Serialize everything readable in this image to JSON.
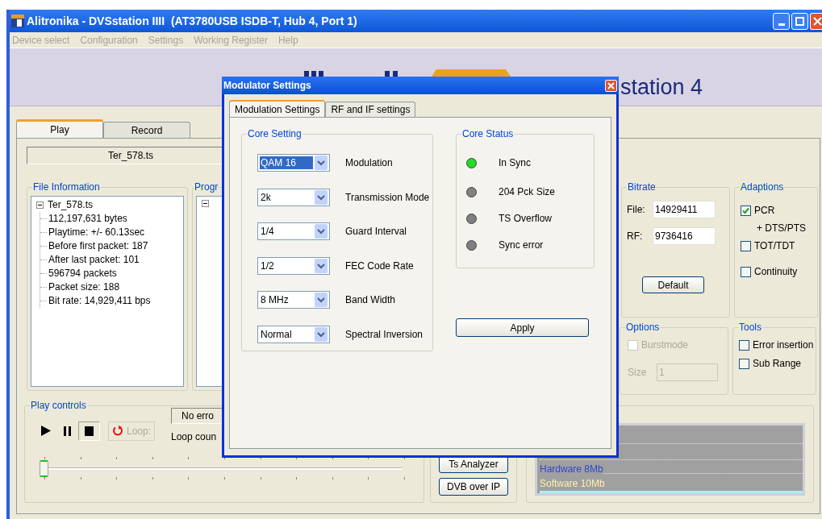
{
  "window": {
    "title": "Alitronika - DVSstation IIII  (AT3780USB ISDB-T, Hub 4, Port 1)"
  },
  "menu": [
    {
      "label": "Device select",
      "disabled": true
    },
    {
      "label": "Configuration",
      "disabled": true
    },
    {
      "label": "Settings",
      "disabled": true
    },
    {
      "label": "Working Register",
      "disabled": true
    },
    {
      "label": "Help",
      "disabled": true
    }
  ],
  "banner": {
    "text": "station 4"
  },
  "tabs": [
    {
      "label": "Play",
      "selected": true
    },
    {
      "label": "Record",
      "selected": false
    }
  ],
  "file_name": "Ter_578.ts",
  "file_information": {
    "title": "File Information",
    "tree": [
      {
        "label": "Ter_578.ts",
        "expanded": true,
        "children": [
          {
            "label": "112,197,631 bytes"
          },
          {
            "label": "Playtime: +/- 60.13sec"
          },
          {
            "label": "Before first packet: 187"
          },
          {
            "label": "After last packet: 101"
          },
          {
            "label": "596794 packets"
          },
          {
            "label": "Packet size: 188"
          },
          {
            "label": "Bit rate: 14,929,411 bps"
          }
        ]
      }
    ]
  },
  "programs": {
    "title": "Progr",
    "tree": [
      {
        "expanded": true
      }
    ]
  },
  "bitrate": {
    "title": "Bitrate",
    "fields": [
      {
        "label": "File:",
        "value": "14929411"
      },
      {
        "label": "RF:",
        "value": "9736416"
      }
    ],
    "button": "Default"
  },
  "adaptions": {
    "title": "Adaptions",
    "items": [
      {
        "kind": "checkbox",
        "label": "PCR",
        "checked": true
      },
      {
        "kind": "note",
        "label": "+ DTS/PTS"
      },
      {
        "kind": "checkbox",
        "label": "TOT/TDT",
        "checked": false
      },
      {
        "kind": "checkbox",
        "label": "Continuity",
        "checked": false
      }
    ]
  },
  "options": {
    "title": "Options",
    "burstmode": {
      "label": "Burstmode",
      "checked": false,
      "disabled": true
    },
    "size": {
      "label": "Size",
      "value": "1",
      "disabled": true
    }
  },
  "tools": {
    "title": "Tools",
    "items": [
      {
        "label": "Error insertion",
        "checked": false
      },
      {
        "label": "Sub Range",
        "checked": false
      }
    ]
  },
  "play_controls": {
    "title": "Play controls",
    "transport": [
      {
        "kind": "play",
        "pressed": false
      },
      {
        "kind": "pause",
        "pressed": false
      },
      {
        "kind": "stop",
        "pressed": true
      }
    ],
    "loop": {
      "label": "Loop:",
      "disabled": true
    },
    "status": "No erro",
    "loop_count": "Loop coun",
    "position": {
      "level": 0
    }
  },
  "side_buttons": [
    "Ts Analyzer",
    "DVB over IP"
  ],
  "buffer_graph": {
    "labels": [
      {
        "text": "Hardware 8Mb",
        "color": "#2f45d8"
      },
      {
        "text": "Software 10Mb",
        "color": "#fff0b0"
      }
    ]
  },
  "dialog": {
    "title": "Modulator Settings",
    "tabs": [
      {
        "label": "Modulation Settings",
        "selected": true
      },
      {
        "label": "RF and IF settings",
        "selected": false
      }
    ],
    "core_setting": {
      "title": "Core Setting",
      "rows": [
        {
          "value": "QAM 16",
          "label": "Modulation",
          "focused": true
        },
        {
          "value": "2k",
          "label": "Transmission Mode",
          "focused": false
        },
        {
          "value": "1/4",
          "label": "Guard Interval",
          "focused": false
        },
        {
          "value": "1/2",
          "label": "FEC Code Rate",
          "focused": false
        },
        {
          "value": "8 MHz",
          "label": "Band Width",
          "focused": false
        },
        {
          "value": "Normal",
          "label": "Spectral Inversion",
          "focused": false
        }
      ]
    },
    "core_status": {
      "title": "Core Status",
      "items": [
        {
          "label": "In Sync",
          "on": true
        },
        {
          "label": "204 Pck Size",
          "on": false
        },
        {
          "label": "TS Overflow",
          "on": false
        },
        {
          "label": "Sync error",
          "on": false
        }
      ]
    },
    "apply": "Apply"
  }
}
